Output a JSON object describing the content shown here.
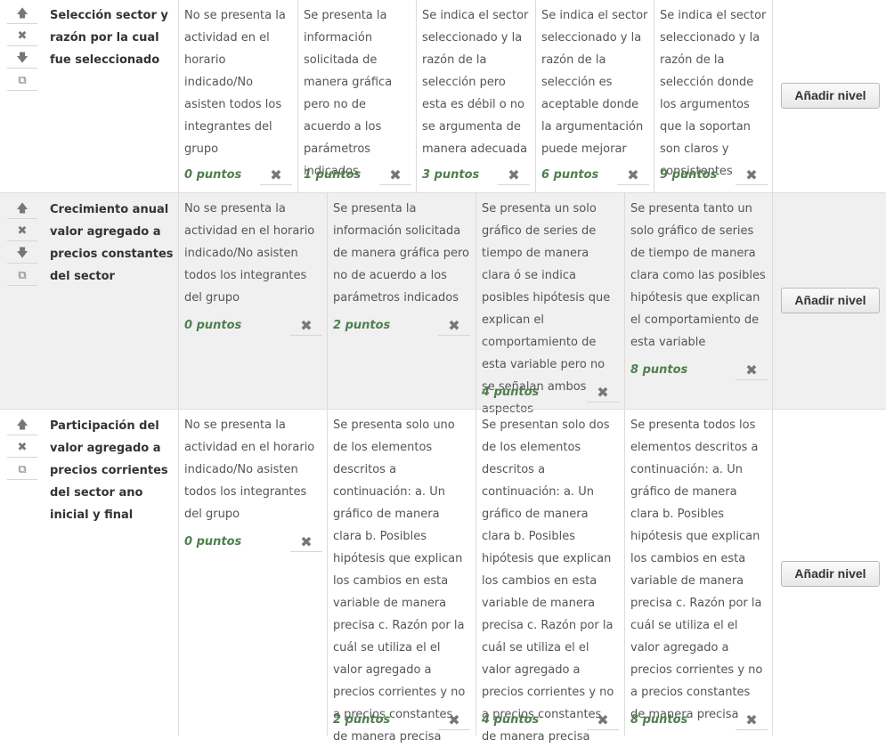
{
  "add_level_label": "Añadir nivel",
  "icons": {
    "up": "arrow-up-icon",
    "delete": "close-icon",
    "down": "arrow-down-icon",
    "duplicate": "duplicate-icon"
  },
  "accent": "#4f7f4f",
  "criteria": [
    {
      "title": "Selección sector y razón por la cual fue seleccionado",
      "levels": [
        {
          "text": "No se presenta la actividad en el horario indicado/No asisten todos los integrantes del grupo",
          "points": "0 puntos"
        },
        {
          "text": "Se presenta la información solicitada de manera gráfica pero no de acuerdo a los parámetros indicados",
          "points": "1 puntos"
        },
        {
          "text": "Se indica el sector seleccionado y la razón de la selección pero esta es débil o no se argumenta de manera adecuada",
          "points": "3 puntos"
        },
        {
          "text": "Se indica el sector seleccionado y la razón de la selección es aceptable donde la argumentación puede mejorar",
          "points": "6 puntos"
        },
        {
          "text": "Se indica el sector seleccionado y la razón de la selección donde los argumentos que la soportan son claros y consistentes",
          "points": "9 puntos"
        }
      ]
    },
    {
      "title": "Crecimiento anual valor agregado a precios constantes del sector",
      "levels": [
        {
          "text": "No se presenta la actividad en el horario indicado/No asisten todos los integrantes del grupo",
          "points": "0 puntos"
        },
        {
          "text": "Se presenta la información solicitada de manera gráfica pero no de acuerdo a los parámetros indicados",
          "points": "2 puntos"
        },
        {
          "text": "Se presenta un solo gráfico de series de tiempo de manera clara ó se indica posibles hipótesis que explican el comportamiento de esta variable pero no se señalan ambos aspectos",
          "points": "4 puntos"
        },
        {
          "text": "Se presenta tanto un solo gráfico de series de tiempo de manera clara como las posibles hipótesis que explican el comportamiento de esta variable",
          "points": "8 puntos"
        }
      ]
    },
    {
      "title": "Participación del valor agregado a precios corrientes del sector ano inicial y final",
      "levels": [
        {
          "text": "No se presenta la actividad en el horario indicado/No asisten todos los integrantes del grupo",
          "points": "0 puntos"
        },
        {
          "text": "Se presenta solo uno de los elementos descritos a continuación: a. Un gráfico de manera clara b. Posibles hipótesis que explican los cambios en esta variable de manera precisa c. Razón por la cuál se utiliza el el valor agregado a precios corrientes y no a precios constantes de manera precisa",
          "points": "2 puntos"
        },
        {
          "text": "Se presentan solo dos de los elementos descritos a continuación: a. Un gráfico de manera clara b. Posibles hipótesis que explican los cambios en esta variable de manera precisa c. Razón por la cuál se utiliza el el valor agregado a precios corrientes y no a precios constantes de manera precisa",
          "points": "4 puntos"
        },
        {
          "text": "Se presenta todos los elementos descritos a continuación: a. Un gráfico de manera clara b. Posibles hipótesis que explican los cambios en esta variable de manera precisa c. Razón por la cuál se utiliza el el valor agregado a precios corrientes y no a precios constantes de manera precisa",
          "points": "8 puntos"
        }
      ]
    }
  ]
}
